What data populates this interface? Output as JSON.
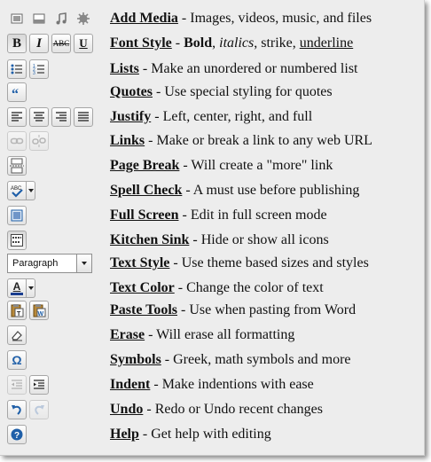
{
  "rows": [
    {
      "name": "Add Media",
      "dash": " - ",
      "desc": "Images, videos, music, and files"
    },
    {
      "name": "Font Style",
      "dash": " - ",
      "desc_parts": [
        "Bold",
        ", ",
        "italics",
        ", strike, ",
        "underline"
      ]
    },
    {
      "name": "Lists",
      "dash": " - ",
      "desc": "Make an unordered or numbered list"
    },
    {
      "name": "Quotes",
      "dash": " - ",
      "desc": "Use special styling for quotes"
    },
    {
      "name": "Justify",
      "dash": " - ",
      "desc": "Left, center, right, and full"
    },
    {
      "name": "Links",
      "dash": " - ",
      "desc": "Make or break a link to any web URL"
    },
    {
      "name": "Page Break",
      "dash": " - ",
      "desc": "Will create a \"more\" link"
    },
    {
      "name": "Spell Check",
      "dash": " - ",
      "desc": "A must use before publishing"
    },
    {
      "name": "Full Screen",
      "dash": " - ",
      "desc": "Edit in full screen mode"
    },
    {
      "name": "Kitchen Sink",
      "dash": " - ",
      "desc": "Hide or show all icons"
    },
    {
      "name": "Text Style",
      "dash": " - ",
      "desc": "Use theme based sizes and styles"
    },
    {
      "name": "Text Color",
      "dash": " - ",
      "desc": "Change the color of text"
    },
    {
      "name": "Paste Tools",
      "dash": " - ",
      "desc": "Use when pasting from Word"
    },
    {
      "name": "Erase",
      "dash": " - ",
      "desc": "Will erase all formatting"
    },
    {
      "name": "Symbols",
      "dash": " - ",
      "desc": "Greek, math symbols and more"
    },
    {
      "name": "Indent",
      "dash": " - ",
      "desc": "Make indentions with ease"
    },
    {
      "name": "Undo",
      "dash": " - ",
      "desc": "Redo or Undo recent changes"
    },
    {
      "name": "Help",
      "dash": " - ",
      "desc": "Get help with editing"
    }
  ],
  "buttons": {
    "bold": "B",
    "italic": "I",
    "strike": "ABC",
    "underline": "U",
    "text_style_value": "Paragraph",
    "text_color_letter": "A",
    "symbols": "Ω",
    "help": "?"
  },
  "colors": {
    "panel_bg": "#ededed",
    "accent_blue": "#1f5fa8",
    "text_color_bar": "#1a3d8f"
  }
}
